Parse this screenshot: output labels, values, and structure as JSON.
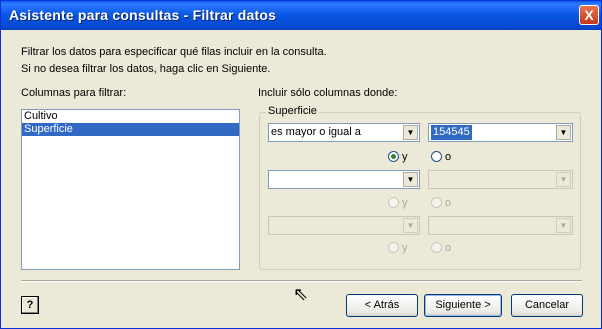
{
  "window": {
    "title": "Asistente para consultas - Filtrar datos",
    "close_label": "X"
  },
  "instructions": {
    "line1": "Filtrar los datos para especificar qué filas incluir en la consulta.",
    "line2": "Si no desea filtrar los datos, haga clic en Siguiente."
  },
  "columns": {
    "label": "Columnas para filtrar:",
    "items": [
      {
        "label": "Cultivo"
      },
      {
        "label": "Superficie",
        "selected": true
      }
    ]
  },
  "criteria": {
    "label": "Incluir sólo columnas donde:",
    "group_title": "Superficie",
    "rows": [
      {
        "operator": "es mayor o igual a",
        "value": "154545"
      },
      {
        "operator": "",
        "value": ""
      },
      {
        "operator": "",
        "value": ""
      }
    ],
    "connectors": [
      {
        "y_label": "y",
        "o_label": "o",
        "selected": "y"
      },
      {
        "y_label": "y",
        "o_label": "o",
        "selected": null
      },
      {
        "y_label": "y",
        "o_label": "o",
        "selected": null
      }
    ]
  },
  "buttons": {
    "help": "?",
    "back": "< Atrás",
    "next": "Siguiente >",
    "cancel": "Cancelar"
  },
  "colors": {
    "titlebar": "#0a58e6",
    "selection": "#316ac5",
    "window_bg": "#ece9d8"
  }
}
